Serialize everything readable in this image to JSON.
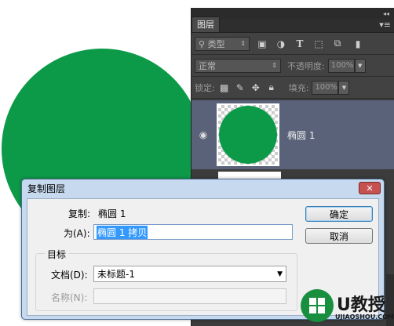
{
  "ps_panel": {
    "tab": "图层",
    "collapse_icon": "double-chevron-icon",
    "menu_icon": "panel-menu-icon",
    "filter_label": "类型",
    "blend_mode": "正常",
    "opacity_label": "不透明度:",
    "opacity_value": "100%",
    "lock_label": "锁定:",
    "fill_label": "填充:",
    "fill_value": "100%",
    "layer_name": "椭圆 1"
  },
  "colors": {
    "circle": "#0d9a48",
    "dialog_frame": "#c6d9ee",
    "selection": "#3399ff"
  },
  "dialog": {
    "title": "复制图层",
    "close": "✕",
    "duplicate_label": "复制:",
    "duplicate_value": "椭圆 1",
    "as_label": "为(A):",
    "as_value": "椭圆 1 拷贝",
    "ok": "确定",
    "cancel": "取消",
    "target_group": "目标",
    "document_label": "文档(D):",
    "document_value": "未标题-1",
    "name_label": "名称(N):",
    "name_value": ""
  },
  "watermark": {
    "brand": "U教授",
    "site": "UJIAOSHOU.COM"
  }
}
